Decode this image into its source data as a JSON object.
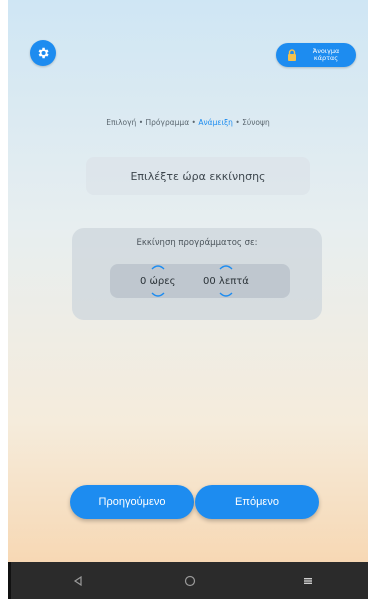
{
  "header": {
    "settings_icon": "gear-icon",
    "unlock": {
      "icon": "lock-icon",
      "line1": "Άνοιγμα",
      "line2": "κάρτας"
    }
  },
  "breadcrumb": {
    "items": [
      {
        "label": "Επιλογή",
        "active": false
      },
      {
        "label": "Πρόγραμμα",
        "active": false
      },
      {
        "label": "Ανάμειξη",
        "active": true
      },
      {
        "label": "Σύνοψη",
        "active": false
      }
    ],
    "separator": "•"
  },
  "title": "Επιλέξτε ώρα εκκίνησης",
  "schedule": {
    "label": "Εκκίνηση προγράμματος σε:",
    "hours": "0 ώρες",
    "minutes": "00 λεπτά"
  },
  "buttons": {
    "prev_label": "Προηγούμενο",
    "next_label": "Επόμενο"
  },
  "colors": {
    "accent": "#1d8cf0",
    "navbar": "#2b2b2b"
  }
}
